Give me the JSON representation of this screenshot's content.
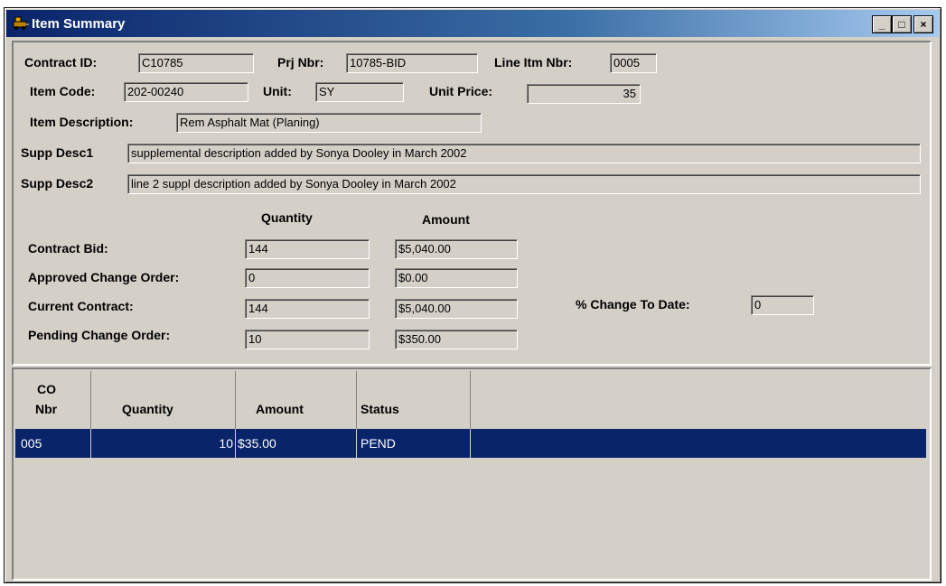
{
  "window": {
    "title": "Item Summary",
    "minimize_glyph": "_",
    "restore_glyph": "□",
    "close_glyph": "×"
  },
  "header": {
    "contract_id_label": "Contract ID:",
    "contract_id": "C10785",
    "prj_nbr_label": "Prj Nbr:",
    "prj_nbr": "10785-BID",
    "line_itm_nbr_label": "Line Itm Nbr:",
    "line_itm_nbr": "0005",
    "item_code_label": "Item Code:",
    "item_code": "202-00240",
    "unit_label": "Unit:",
    "unit": "SY",
    "unit_price_label": "Unit Price:",
    "unit_price": "35",
    "item_desc_label": "Item Description:",
    "item_desc": "Rem Asphalt Mat (Planing)",
    "supp_desc1_label": "Supp Desc1",
    "supp_desc1": "supplemental description added by Sonya Dooley in March 2002",
    "supp_desc2_label": "Supp Desc2",
    "supp_desc2": "line 2 suppl description added by Sonya Dooley in March 2002"
  },
  "summary": {
    "quantity_header": "Quantity",
    "amount_header": "Amount",
    "rows": [
      {
        "label": "Contract Bid:",
        "quantity": "144",
        "amount": "$5,040.00"
      },
      {
        "label": "Approved Change Order:",
        "quantity": "0",
        "amount": "$0.00"
      },
      {
        "label": "Current Contract:",
        "quantity": "144",
        "amount": "$5,040.00"
      },
      {
        "label": "Pending Change Order:",
        "quantity": "10",
        "amount": "$350.00"
      }
    ],
    "pct_change_label": "% Change To Date:",
    "pct_change": "0"
  },
  "change_orders": {
    "columns": [
      "CO\nNbr",
      "Quantity",
      "Amount",
      "Status"
    ],
    "col_co_line1": "CO",
    "col_co_line2": "Nbr",
    "rows": [
      {
        "co_nbr": "005",
        "quantity": "10",
        "amount": "$35.00",
        "status": "PEND"
      }
    ]
  },
  "colors": {
    "face": "#d4d0c8",
    "selection": "#0a246a",
    "title_start": "#0a246a",
    "title_end": "#a6caf0"
  }
}
